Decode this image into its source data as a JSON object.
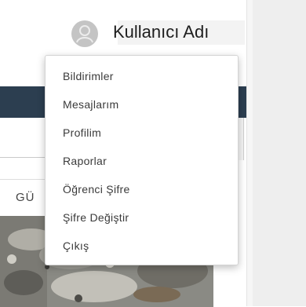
{
  "header": {
    "user_name": "Kullanıcı Adı"
  },
  "user_menu": {
    "items": [
      {
        "label": "Bildirimler"
      },
      {
        "label": "Mesajlarım"
      },
      {
        "label": "Profilim"
      },
      {
        "label": "Raporlar"
      },
      {
        "label": "Öğrenci Şifre"
      },
      {
        "label": "Şifre Değiştir"
      },
      {
        "label": "Çıkış"
      }
    ]
  },
  "card": {
    "title": "GÜ"
  },
  "icons": {
    "avatar": "user-icon"
  },
  "colors": {
    "navbar": "#2c3e50",
    "avatar": "#c4c4c4",
    "side_panel": "#eeeeee"
  }
}
